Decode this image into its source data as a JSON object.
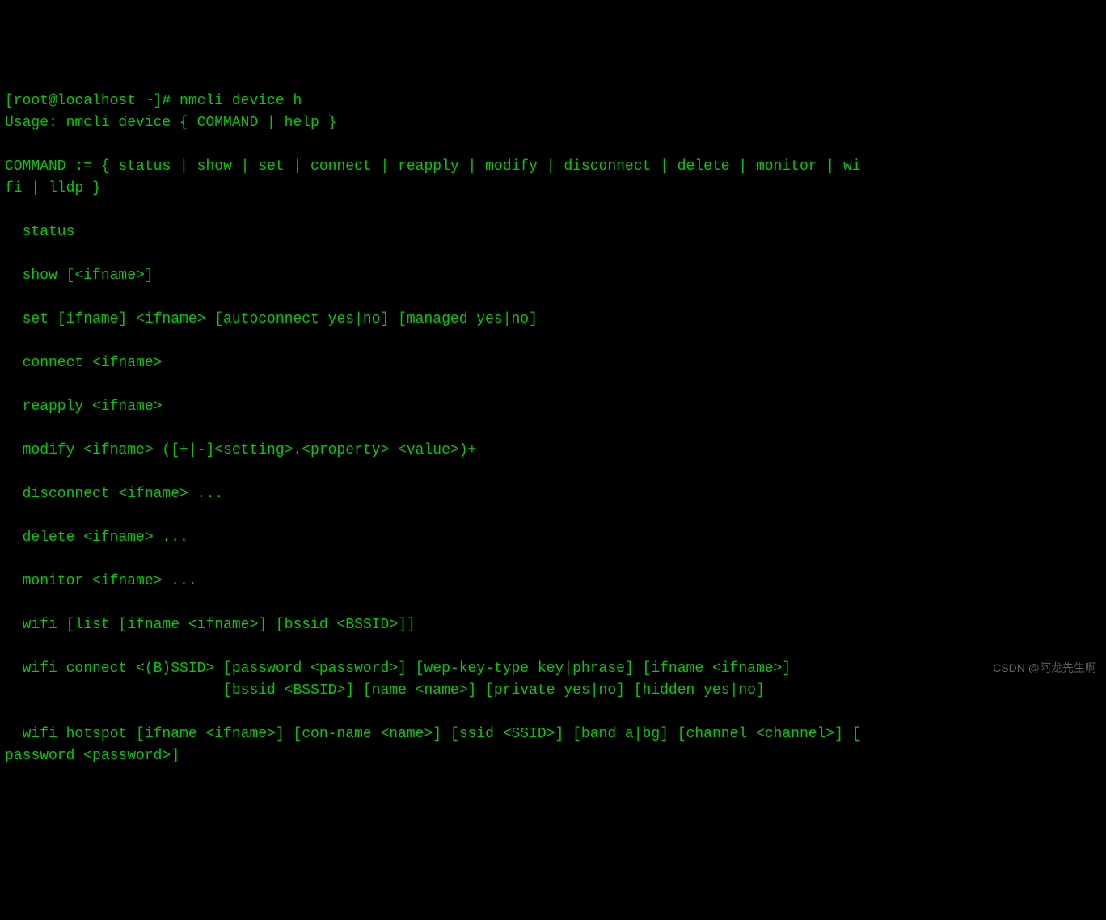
{
  "terminal": {
    "lines": [
      "[root@localhost ~]# nmcli device h",
      "Usage: nmcli device { COMMAND | help }",
      "",
      "COMMAND := { status | show | set | connect | reapply | modify | disconnect | delete | monitor | wi",
      "fi | lldp }",
      "",
      "  status",
      "",
      "  show [<ifname>]",
      "",
      "  set [ifname] <ifname> [autoconnect yes|no] [managed yes|no]",
      "",
      "  connect <ifname>",
      "",
      "  reapply <ifname>",
      "",
      "  modify <ifname> ([+|-]<setting>.<property> <value>)+",
      "",
      "  disconnect <ifname> ...",
      "",
      "  delete <ifname> ...",
      "",
      "  monitor <ifname> ...",
      "",
      "  wifi [list [ifname <ifname>] [bssid <BSSID>]]",
      "",
      "  wifi connect <(B)SSID> [password <password>] [wep-key-type key|phrase] [ifname <ifname>]",
      "                         [bssid <BSSID>] [name <name>] [private yes|no] [hidden yes|no]",
      "",
      "  wifi hotspot [ifname <ifname>] [con-name <name>] [ssid <SSID>] [band a|bg] [channel <channel>] [",
      "password <password>]"
    ]
  },
  "watermark": "CSDN @阿龙先生啊"
}
